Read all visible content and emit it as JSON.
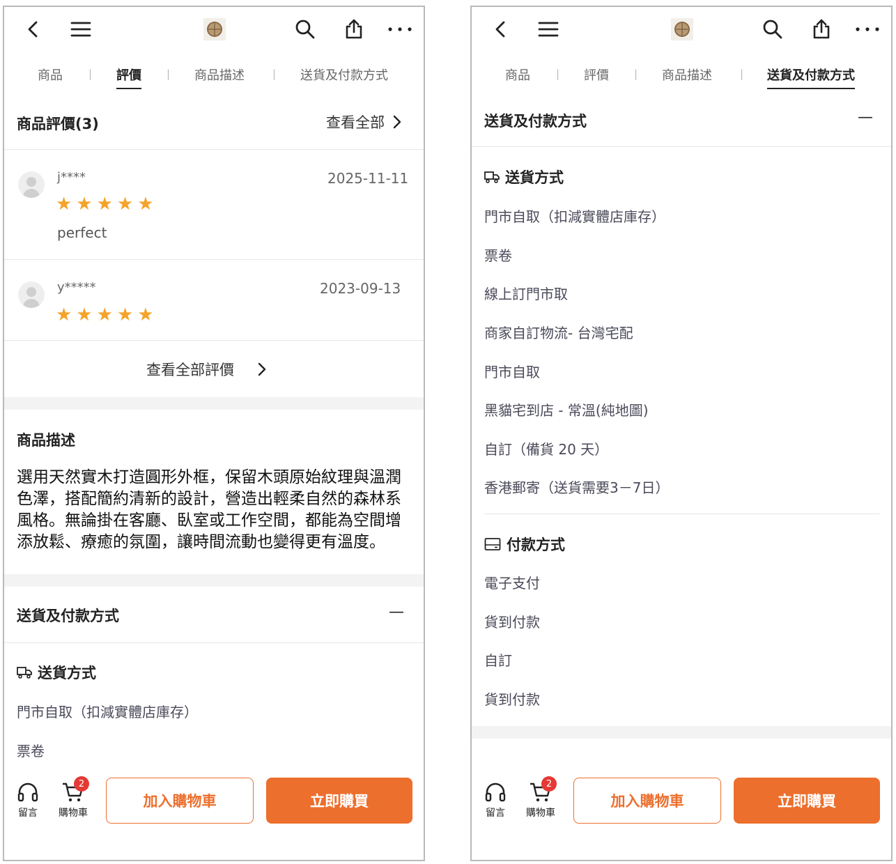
{
  "nav": {
    "icons": [
      "back-icon",
      "menu-icon",
      "store-logo",
      "search-icon",
      "share-icon",
      "more-icon"
    ]
  },
  "tabs": [
    "商品",
    "評價",
    "商品描述",
    "送貨及付款方式"
  ],
  "tab_separator": "|",
  "reviews": {
    "title": "商品評價(3)",
    "view_all": "查看全部",
    "items": [
      {
        "user": "j****",
        "date": "2025-11-11",
        "stars": 5,
        "comment": "perfect"
      },
      {
        "user": "y*****",
        "date": "2023-09-13",
        "stars": 5,
        "comment": ""
      }
    ],
    "view_all_reviews": "查看全部評價"
  },
  "description": {
    "title": "商品描述",
    "text": "選用天然實木打造圓形外框，保留木頭原始紋理與溫潤色澤，搭配簡約清新的設計，營造出輕柔自然的森林系風格。無論掛在客廳、臥室或工作空間，都能為空間增添放鬆、療癒的氛圍，讓時間流動也變得更有溫度。"
  },
  "shipping_payment": {
    "title": "送貨及付款方式",
    "collapse_symbol": "—",
    "shipping_title": "送貨方式",
    "shipping_options": [
      "門市自取（扣減實體店庫存）",
      "票卷",
      "線上訂門市取",
      "商家自訂物流- 台灣宅配",
      "門市自取",
      "黑貓宅到店 - 常溫(純地圖)",
      "自訂（備貨 20 天）",
      "香港郵寄（送貨需要3－7日）"
    ],
    "payment_title": "付款方式",
    "payment_options": [
      "電子支付",
      "貨到付款",
      "自訂",
      "貨到付款"
    ]
  },
  "bottom_bar": {
    "chat_label": "留言",
    "cart_label": "購物車",
    "cart_count": "2",
    "add_to_cart": "加入購物車",
    "buy_now": "立即購買"
  },
  "colors": {
    "accent": "#ec6f2d",
    "star": "#f5a32a",
    "badge": "#e53935"
  },
  "active_tab": {
    "left_screen": "評價",
    "right_screen": "送貨及付款方式"
  }
}
